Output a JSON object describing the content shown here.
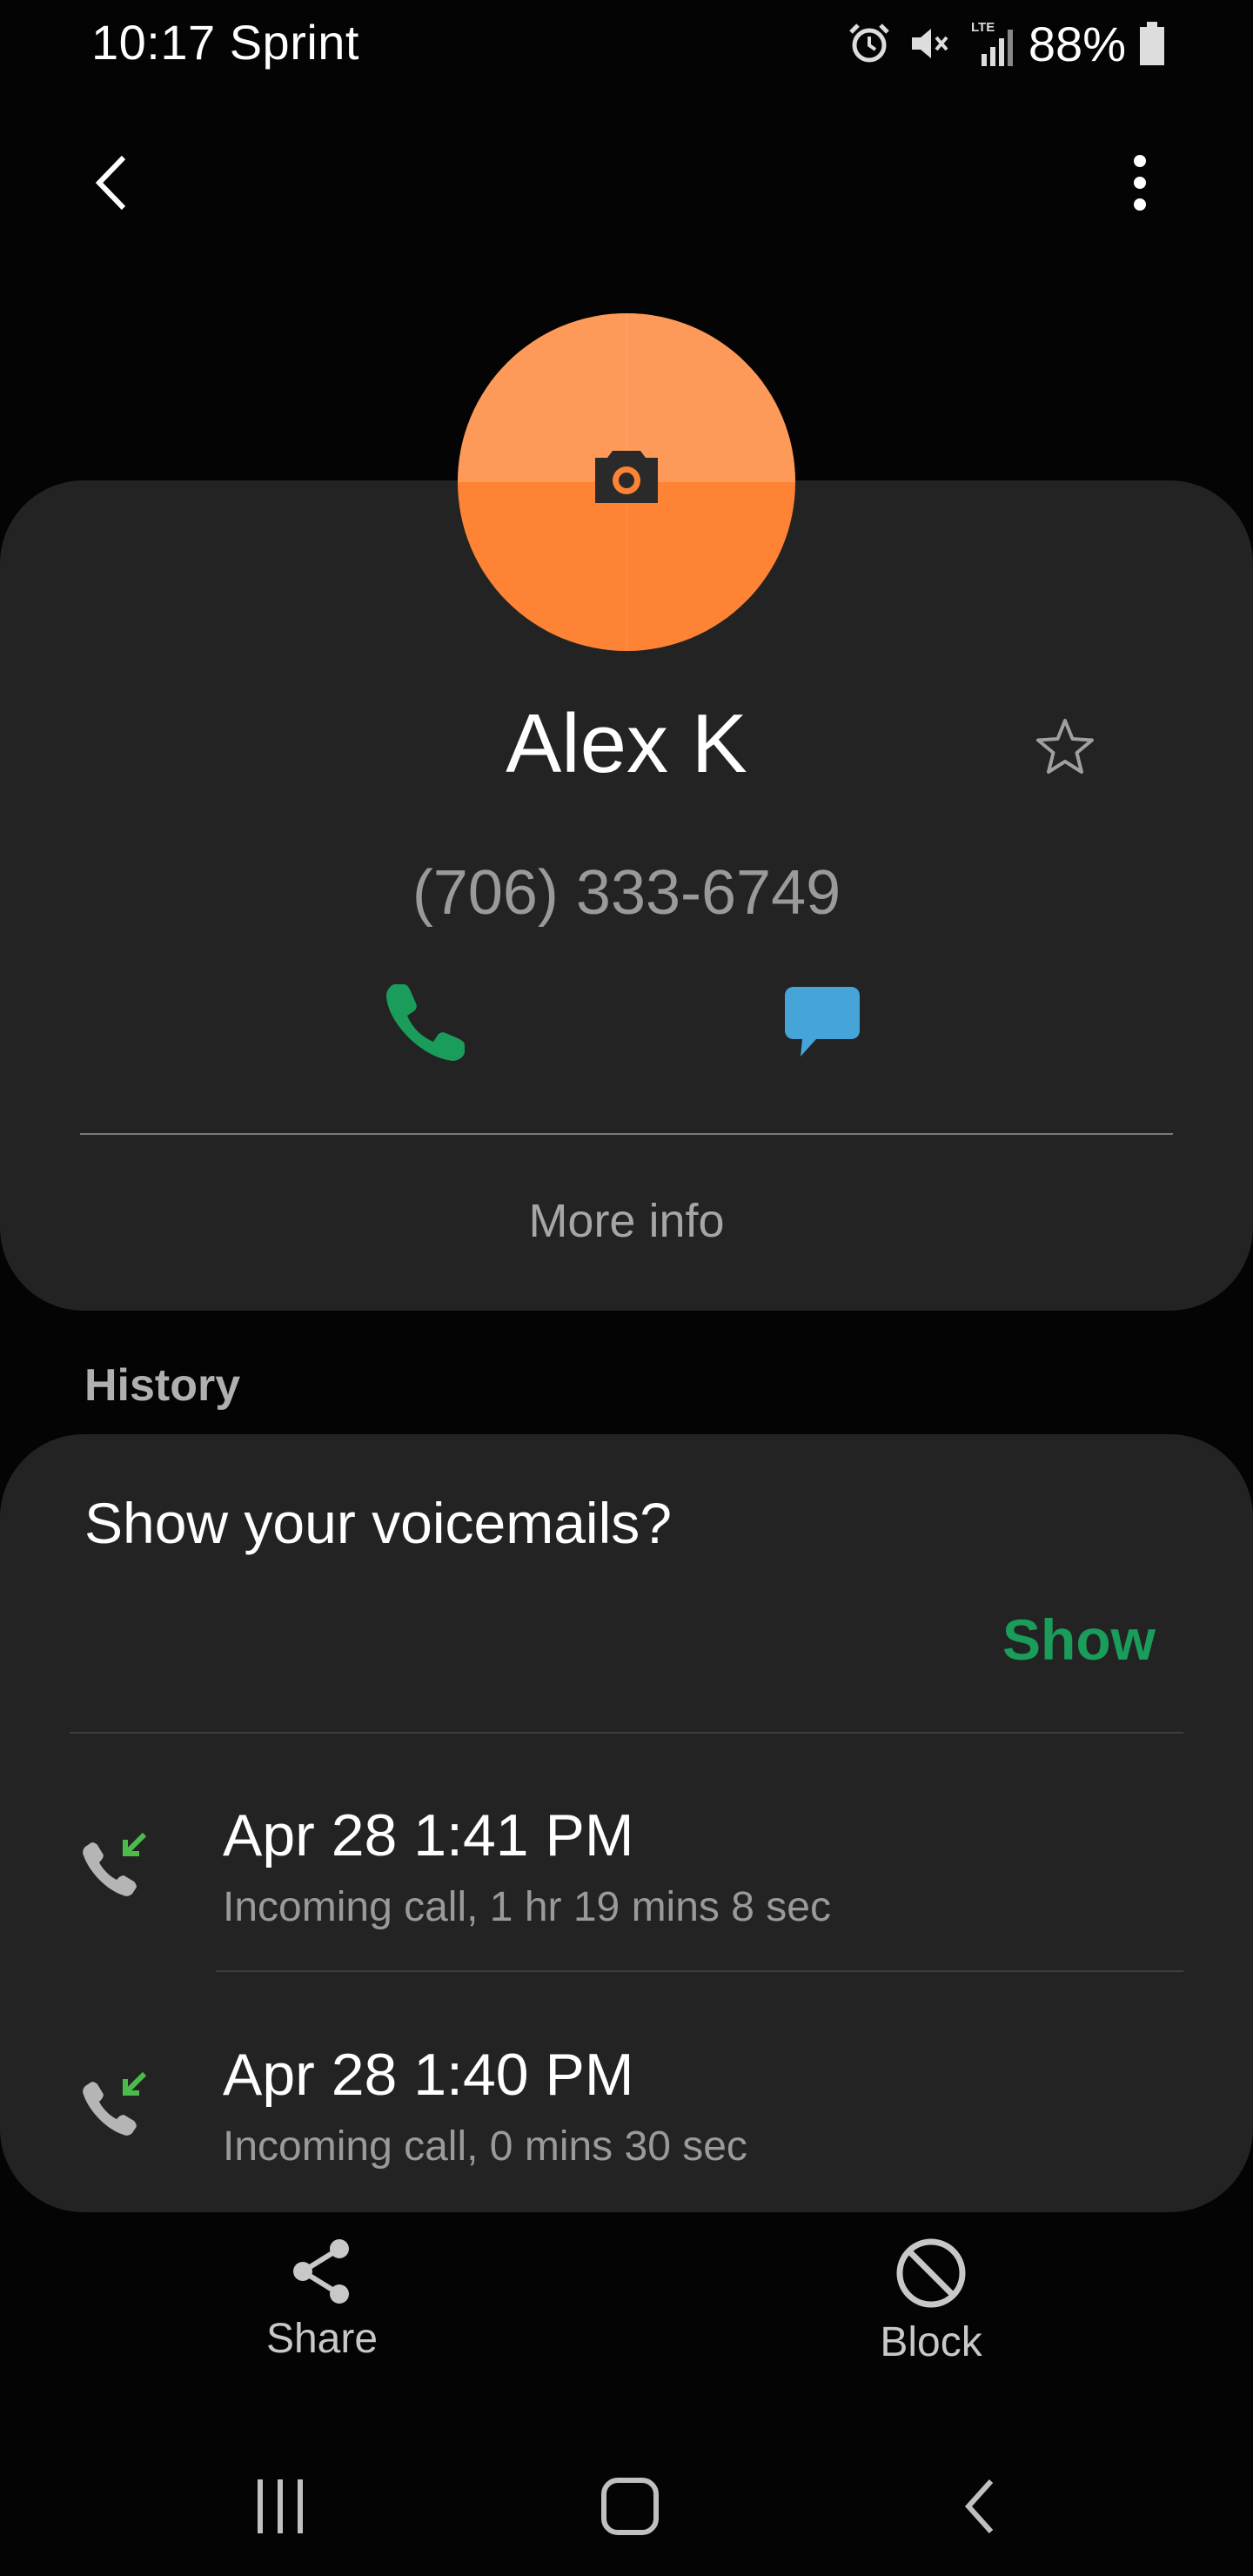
{
  "status_bar": {
    "time_carrier": "10:17 Sprint",
    "network_label": "LTE",
    "battery": "88%",
    "icons": [
      "alarm-icon",
      "vibrate-mute-icon",
      "lte-signal-icon",
      "battery-icon"
    ]
  },
  "app_bar": {
    "back_icon": "chevron-left-icon",
    "more_icon": "more-vertical-icon"
  },
  "contact": {
    "name": "Alex K",
    "phone": "(706) 333-6749",
    "avatar_color": "#fe8335",
    "avatar_icon": "camera-icon",
    "favorite_icon": "star-outline-icon",
    "call_icon": "phone-icon",
    "call_color": "#1a9d5b",
    "message_icon": "message-icon",
    "message_color": "#45a4d8",
    "more_info_label": "More info"
  },
  "history": {
    "heading": "History",
    "voicemail_prompt": "Show your voicemails?",
    "show_label": "Show",
    "entries": [
      {
        "time": "Apr 28 1:41 PM",
        "detail": "Incoming call, 1 hr 19 mins 8 sec",
        "icon": "incoming-call-icon"
      },
      {
        "time": "Apr 28 1:40 PM",
        "detail": "Incoming call, 0 mins 30 sec",
        "icon": "incoming-call-icon"
      }
    ]
  },
  "actions": {
    "share_label": "Share",
    "block_label": "Block"
  },
  "nav_bar": {
    "recents_icon": "recents-icon",
    "home_icon": "home-icon",
    "back_icon": "nav-back-icon"
  }
}
